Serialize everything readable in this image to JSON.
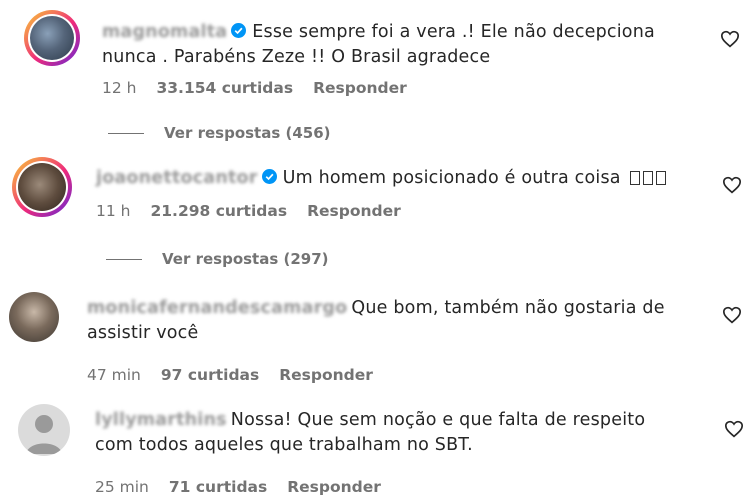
{
  "comments": [
    {
      "username": "magnomalta",
      "verified": true,
      "text_lines": [
        "Esse sempre foi a vera .! Ele não decepciona",
        "nunca . Parabéns Zeze !! O Brasil agradece"
      ],
      "time": "12 h",
      "likes": "33.154 curtidas",
      "reply": "Responder",
      "view_replies": "Ver respostas (456)"
    },
    {
      "username": "joaonettocantor",
      "verified": true,
      "text_lines": [
        "Um homem posicionado é outra coisa"
      ],
      "time": "11 h",
      "likes": "21.298 curtidas",
      "reply": "Responder",
      "view_replies": "Ver respostas (297)"
    },
    {
      "username": "monicafernandescamargo",
      "verified": false,
      "text_lines": [
        "Que bom, também não gostaria de",
        "assistir você"
      ],
      "time": "47 min",
      "likes": "97 curtidas",
      "reply": "Responder"
    },
    {
      "username": "lyllymarthins",
      "verified": false,
      "text_lines": [
        "Nossa! Que sem noção e que falta de respeito",
        "com todos aqueles que trabalham no SBT."
      ],
      "time": "25 min",
      "likes": "71 curtidas",
      "reply": "Responder"
    }
  ],
  "icons": {
    "like": "heart-outline-icon",
    "verified": "verified-badge-icon"
  },
  "colors": {
    "text": "#262626",
    "secondary": "#737373",
    "verified": "#0095f6",
    "ring_start": "#f9ce34",
    "ring_end": "#6228d7"
  }
}
